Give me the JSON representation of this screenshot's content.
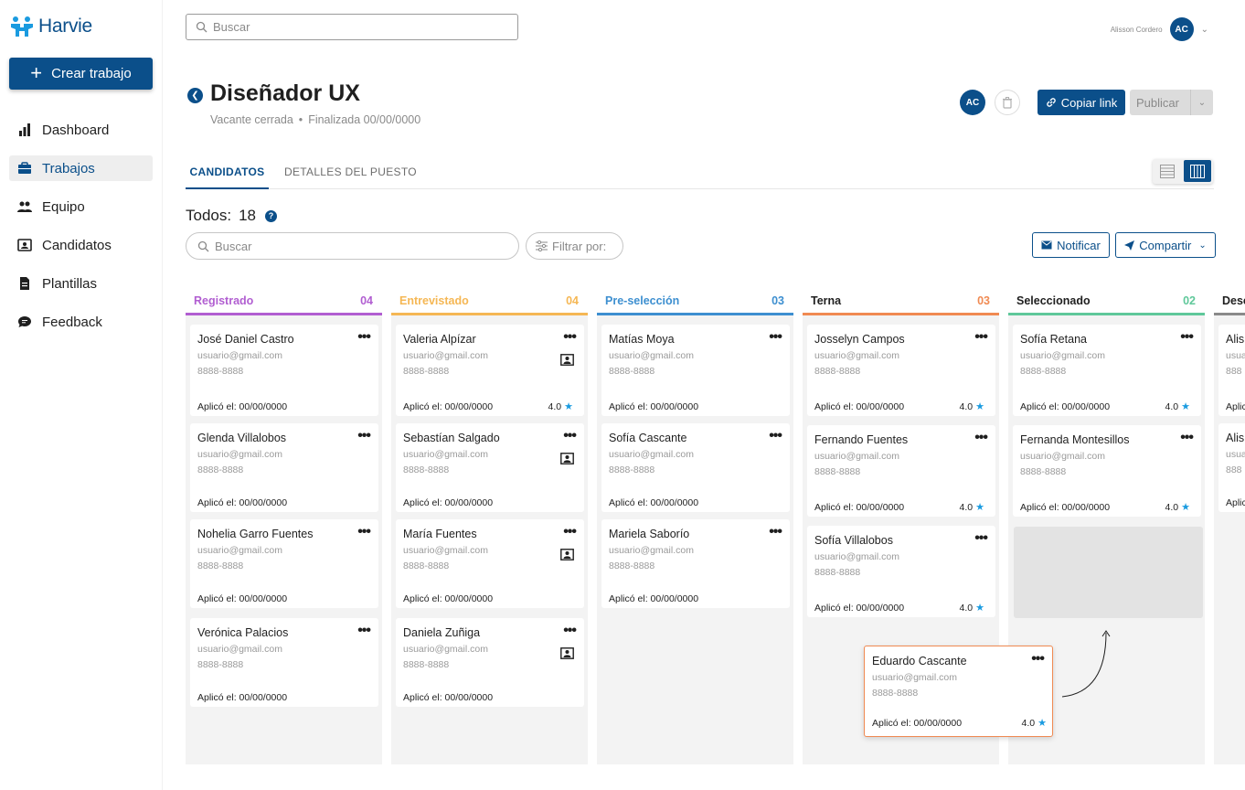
{
  "app": {
    "name": "Harvie"
  },
  "sidebar": {
    "create_label": "Crear trabajo",
    "items": [
      {
        "label": "Dashboard",
        "icon": "bar-chart-icon",
        "active": false
      },
      {
        "label": "Trabajos",
        "icon": "briefcase-icon",
        "active": true
      },
      {
        "label": "Equipo",
        "icon": "team-icon",
        "active": false
      },
      {
        "label": "Candidatos",
        "icon": "contact-card-icon",
        "active": false
      },
      {
        "label": "Plantillas",
        "icon": "document-icon",
        "active": false
      },
      {
        "label": "Feedback",
        "icon": "chat-icon",
        "active": false
      }
    ]
  },
  "topbar": {
    "search_placeholder": "Buscar",
    "user_name": "Alisson Cordero",
    "user_initials": "AC"
  },
  "job": {
    "title": "Diseñador UX",
    "status": "Vacante cerrada",
    "separator": "•",
    "finished": "Finalizada 00/00/0000",
    "owner_initials": "AC",
    "copy_link_label": "Copiar link",
    "publish_label": "Publicar"
  },
  "tabs": [
    {
      "label": "CANDIDATOS",
      "active": true
    },
    {
      "label": "DETALLES DEL PUESTO",
      "active": false
    }
  ],
  "board_header": {
    "total_label": "Todos:",
    "total_value": "18",
    "help": "?",
    "search_placeholder": "Buscar",
    "filter_label": "Filtrar por:",
    "notify_label": "Notificar",
    "share_label": "Compartir"
  },
  "columns": [
    {
      "title": "Registrado",
      "count": "04",
      "color": "#b15ed1",
      "cards": [
        {
          "name": "José Daniel Castro",
          "email": "usuario@gmail.com",
          "phone": "8888-8888",
          "applied": "Aplicó el: 00/00/0000"
        },
        {
          "name": "Glenda Villalobos",
          "email": "usuario@gmail.com",
          "phone": "8888-8888",
          "applied": "Aplicó el: 00/00/0000"
        },
        {
          "name": "Nohelia Garro Fuentes",
          "email": "usuario@gmail.com",
          "phone": "8888-8888",
          "applied": "Aplicó el: 00/00/0000"
        },
        {
          "name": "Verónica Palacios",
          "email": "usuario@gmail.com",
          "phone": "8888-8888",
          "applied": "Aplicó el: 00/00/0000"
        }
      ]
    },
    {
      "title": "Entrevistado",
      "count": "04",
      "color": "#f5b754",
      "cards": [
        {
          "name": "Valeria Alpízar",
          "email": "usuario@gmail.com",
          "phone": "8888-8888",
          "applied": "Aplicó el: 00/00/0000",
          "rating": "4.0"
        },
        {
          "name": "Sebastían Salgado",
          "email": "usuario@gmail.com",
          "phone": "8888-8888",
          "applied": "Aplicó el: 00/00/0000"
        },
        {
          "name": "María Fuentes",
          "email": "usuario@gmail.com",
          "phone": "8888-8888",
          "applied": "Aplicó el: 00/00/0000"
        },
        {
          "name": "Daniela Zuñiga",
          "email": "usuario@gmail.com",
          "phone": "8888-8888",
          "applied": "Aplicó el: 00/00/0000"
        }
      ]
    },
    {
      "title": "Pre-selección",
      "count": "03",
      "color": "#3d8fd0",
      "cards": [
        {
          "name": "Matías Moya",
          "email": "usuario@gmail.com",
          "phone": "8888-8888",
          "applied": "Aplicó el: 00/00/0000"
        },
        {
          "name": "Sofía Cascante",
          "email": "usuario@gmail.com",
          "phone": "8888-8888",
          "applied": "Aplicó el: 00/00/0000"
        },
        {
          "name": "Mariela Saborío",
          "email": "usuario@gmail.com",
          "phone": "8888-8888",
          "applied": "Aplicó el: 00/00/0000"
        }
      ]
    },
    {
      "title": "Terna",
      "count": "03",
      "color": "#f08a52",
      "cards": [
        {
          "name": "Josselyn Campos",
          "email": "usuario@gmail.com",
          "phone": "8888-8888",
          "applied": "Aplicó el: 00/00/0000",
          "rating": "4.0"
        },
        {
          "name": "Fernando Fuentes",
          "email": "usuario@gmail.com",
          "phone": "8888-8888",
          "applied": "Aplicó el: 00/00/0000",
          "rating": "4.0"
        },
        {
          "name": "Sofía Villalobos",
          "email": "usuario@gmail.com",
          "phone": "8888-8888",
          "applied": "Aplicó el: 00/00/0000",
          "rating": "4.0"
        }
      ]
    },
    {
      "title": "Seleccionado",
      "count": "02",
      "color": "#5fc89a",
      "cards": [
        {
          "name": "Sofía Retana",
          "email": "usuario@gmail.com",
          "phone": "8888-8888",
          "applied": "Aplicó el: 00/00/0000",
          "rating": "4.0"
        },
        {
          "name": "Fernanda Montesillos",
          "email": "usuario@gmail.com",
          "phone": "8888-8888",
          "applied": "Aplicó el: 00/00/0000",
          "rating": "4.0"
        }
      ]
    },
    {
      "title": "Desc",
      "count": "",
      "color": "#8a8a8a",
      "cards": [
        {
          "name": "Alis",
          "email": "usua",
          "phone": "888",
          "applied": "Aplic"
        },
        {
          "name": "Alis",
          "email": "usua",
          "phone": "888",
          "applied": "Aplic"
        }
      ]
    }
  ],
  "dragging_card": {
    "name": "Eduardo Cascante",
    "email": "usuario@gmail.com",
    "phone": "8888-8888",
    "applied": "Aplicó el: 00/00/0000",
    "rating": "4.0",
    "accent": "#f08a52"
  },
  "colors": {
    "primary": "#0b4f8a",
    "star": "#1a9be0"
  }
}
